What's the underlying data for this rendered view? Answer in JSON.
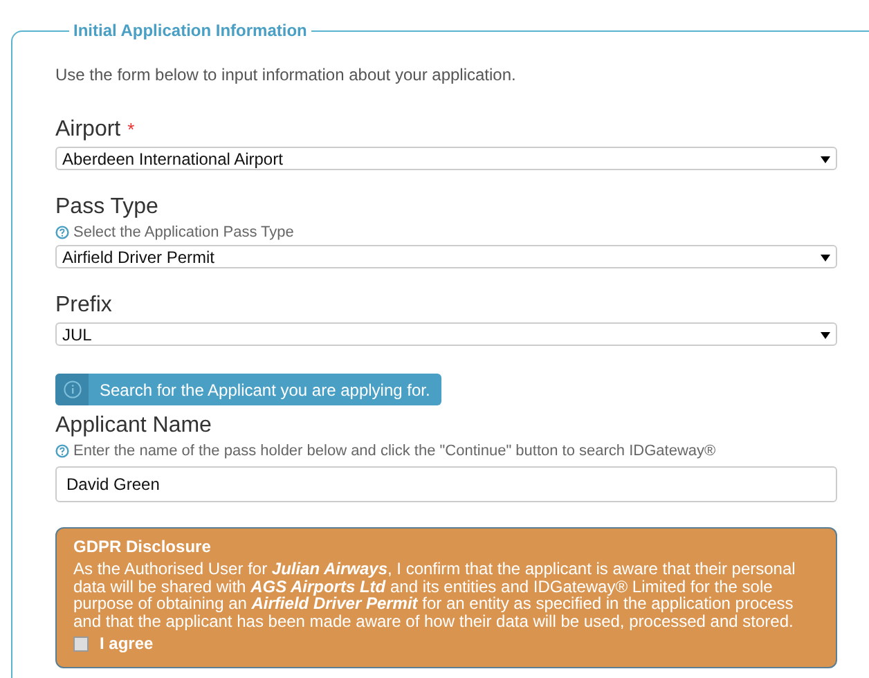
{
  "section": {
    "legend": "Initial Application Information",
    "intro": "Use the form below to input information about your application."
  },
  "fields": [
    {
      "kind": "select",
      "label": "Airport",
      "required_mark": "*",
      "value": "Aberdeen International Airport"
    },
    {
      "kind": "select",
      "label": "Pass Type",
      "hint": "Select the Application Pass Type",
      "value": "Airfield Driver Permit"
    },
    {
      "kind": "select",
      "label": "Prefix",
      "value": "JUL"
    },
    {
      "kind": "info-button",
      "label": "Search for the Applicant you are applying for."
    },
    {
      "kind": "text",
      "label": "Applicant Name",
      "hint": "Enter the name of the pass holder below and click the \"Continue\" button to search IDGateway®",
      "value": "David Green"
    }
  ],
  "gdpr": {
    "title": "GDPR Disclosure",
    "text": "As the Authorised User for **Julian Airways**, I confirm that the applicant is aware that their personal data will be shared with **AGS Airports Ltd** and its entities and IDGateway® Limited for the sole purpose of obtaining an **Airfield Driver Permit** for an entity as specified in the application process and that the applicant has been made aware of how their data will be used, processed and stored.",
    "agree": {
      "label": "I agree",
      "checked": false
    }
  }
}
